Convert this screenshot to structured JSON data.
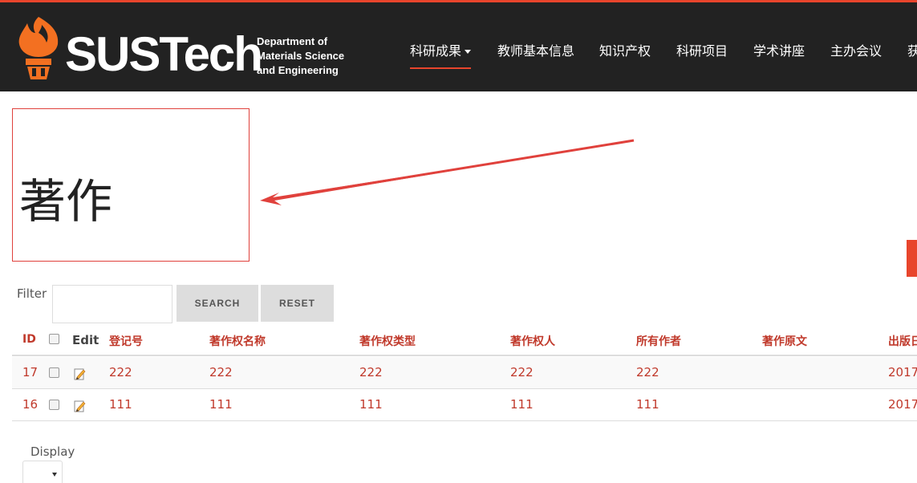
{
  "header": {
    "logo_text": "SUSTech",
    "department_lines": [
      "Department of",
      "Materials Science",
      "and Engineering"
    ],
    "nav": [
      {
        "label": "科研成果",
        "active": true,
        "has_dropdown": true
      },
      {
        "label": "教师基本信息"
      },
      {
        "label": "知识产权"
      },
      {
        "label": "科研项目"
      },
      {
        "label": "学术讲座"
      },
      {
        "label": "主办会议"
      },
      {
        "label": "获"
      }
    ]
  },
  "page": {
    "title": "著作"
  },
  "filter": {
    "label": "Filter",
    "value": "",
    "search_label": "SEARCH",
    "reset_label": "RESET"
  },
  "table": {
    "columns": [
      "ID",
      "",
      "Edit",
      "登记号",
      "著作权名称",
      "著作权类型",
      "著作权人",
      "所有作者",
      "著作原文",
      "出版日"
    ],
    "rows": [
      {
        "id": "17",
        "reg_no": "222",
        "name": "222",
        "type": "222",
        "owner": "222",
        "authors": "222",
        "original": "",
        "pub_date": "2017"
      },
      {
        "id": "16",
        "reg_no": "111",
        "name": "111",
        "type": "111",
        "owner": "111",
        "authors": "111",
        "original": "",
        "pub_date": "2017"
      }
    ]
  },
  "display": {
    "label": "Display",
    "value": ""
  },
  "colors": {
    "accent": "#e8452c",
    "header_bg": "#222222",
    "link": "#c0392b",
    "annotation": "#e0413c"
  },
  "icons": {
    "logo": "flame-torch-icon",
    "edit": "pencil-edit-icon",
    "dropdown": "caret-down-icon"
  }
}
